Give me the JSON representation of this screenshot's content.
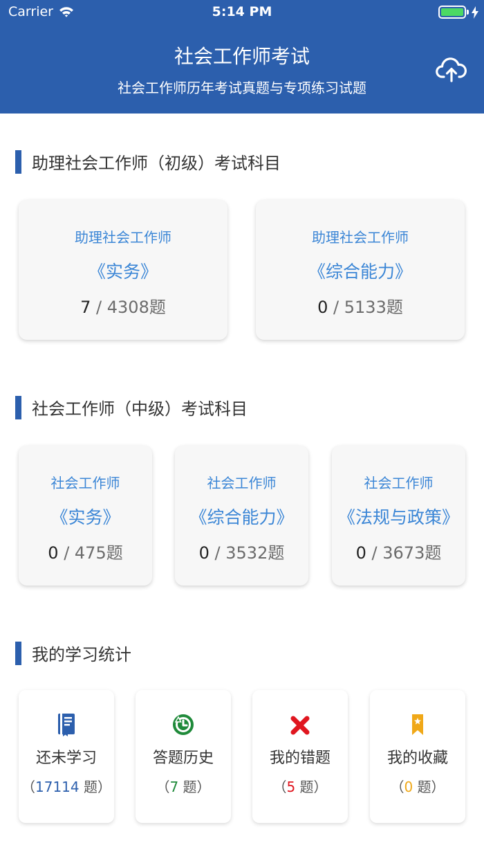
{
  "status_bar": {
    "carrier": "Carrier",
    "time": "5:14 PM"
  },
  "header": {
    "title": "社会工作师考试",
    "subtitle": "社会工作师历年考试真题与专项练习试题"
  },
  "sections": [
    {
      "title": "助理社会工作师（初级）考试科目",
      "cards": [
        {
          "level": "助理社会工作师",
          "subject": "《实务》",
          "done": "7",
          "total": "4308题"
        },
        {
          "level": "助理社会工作师",
          "subject": "《综合能力》",
          "done": "0",
          "total": "5133题"
        }
      ]
    },
    {
      "title": "社会工作师（中级）考试科目",
      "cards": [
        {
          "level": "社会工作师",
          "subject": "《实务》",
          "done": "0",
          "total": "475题"
        },
        {
          "level": "社会工作师",
          "subject": "《综合能力》",
          "done": "0",
          "total": "3532题"
        },
        {
          "level": "社会工作师",
          "subject": "《法规与政策》",
          "done": "0",
          "total": "3673题"
        }
      ]
    }
  ],
  "stats": {
    "title": "我的学习统计",
    "unit": "题",
    "items": [
      {
        "label": "还未学习",
        "count": "17114",
        "color": "#2c5fad",
        "icon": "book-icon"
      },
      {
        "label": "答题历史",
        "count": "7",
        "color": "#1f8a3a",
        "icon": "history-icon"
      },
      {
        "label": "我的错题",
        "count": "5",
        "color": "#e0161f",
        "icon": "wrong-x-icon"
      },
      {
        "label": "我的收藏",
        "count": "0",
        "color": "#f0a818",
        "icon": "bookmark-star-icon"
      }
    ]
  },
  "colors": {
    "header_bg": "#2c5fad",
    "accent": "#3b86d6",
    "section_bar": "#2c5fad"
  }
}
